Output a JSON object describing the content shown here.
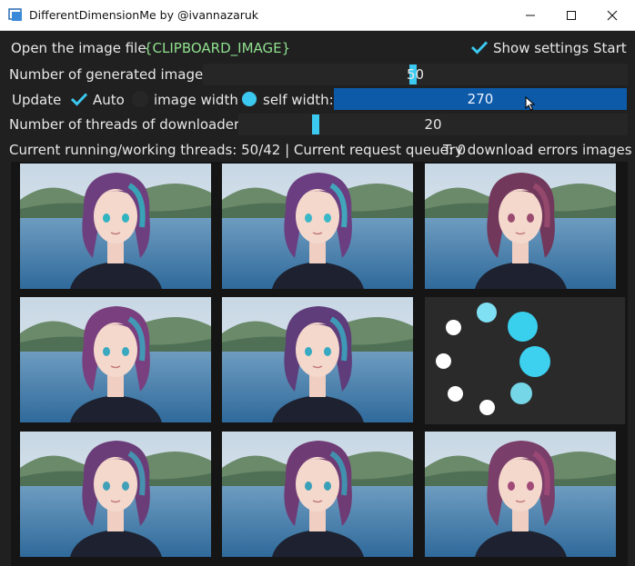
{
  "window": {
    "title": "DifferentDimensionMe by @ivannazaruk",
    "minimize_icon": "minimize-icon",
    "maximize_icon": "maximize-icon",
    "close_icon": "close-icon"
  },
  "controls": {
    "open_file_label": "Open the image file",
    "file_value": "{CLIPBOARD_IMAGE}",
    "show_settings_label": "Show settings",
    "show_settings_checked": true,
    "start_label": "Start",
    "generated_images_label": "Number of generated images",
    "generated_images_value": "50",
    "generated_images_fraction": 0.2,
    "update_label": "Update",
    "auto_label": "Auto",
    "auto_checked": true,
    "image_width_label": "image width",
    "self_width_label": "self width:",
    "self_width_value": "270",
    "threads_label": "Number of threads of downloaders",
    "threads_value": "20",
    "threads_fraction": 0.2,
    "status_text": "Current running/working threads: 50/42 | Current request queue: 0",
    "retry_label": "Try download errors images"
  },
  "grid": {
    "images": [
      {
        "hair": "#6e3f7e",
        "accent": "#2fb4c0"
      },
      {
        "hair": "#6a3e80",
        "accent": "#3ab7c6"
      },
      {
        "hair": "#72385c",
        "accent": "#9a4b6f"
      },
      {
        "hair": "#7a3f7e",
        "accent": "#3aa8c0"
      },
      {
        "hair": "#5f3c7a",
        "accent": "#38a9c2"
      },
      {
        "hair": "#6b3d78",
        "accent": "#40a0b8"
      },
      {
        "hair": "#6f3b74",
        "accent": "#3aa0b8"
      },
      {
        "hair": "#7a3e6a",
        "accent": "#a04a78"
      }
    ],
    "loading_icon": "loading-spinner-icon"
  },
  "colors": {
    "accent": "#3bc9f0",
    "file_value": "#8fe08f",
    "selected_bar": "#0c5aa8"
  }
}
